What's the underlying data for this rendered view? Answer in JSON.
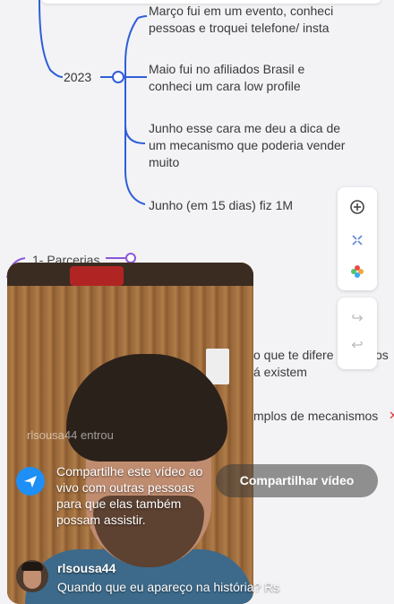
{
  "mindmap": {
    "year": "2023",
    "items": [
      "Março fui em um evento, conheci pessoas e troquei telefone/ insta",
      "Maio fui no afiliados Brasil e conheci um cara low profile",
      "Junho esse cara me deu a dica de um mecanismo que poderia vender muito",
      "Junho (em 15 dias) fiz 1M"
    ],
    "section_label": "1- Parcerias",
    "partial_texts": [
      "o que te difere",
      "á existem",
      "os",
      "mplos de mecanismos"
    ]
  },
  "toolbar": {
    "icons": [
      "add-icon",
      "fit-screen-icon",
      "palette-icon"
    ],
    "icons2": [
      "redo-icon",
      "undo-icon"
    ]
  },
  "live": {
    "joined_text": "rlsousa44 entrou",
    "share_message": "Compartilhe este vídeo ao vivo com outras pessoas para que elas também possam assistir.",
    "share_button": "Compartilhar vídeo",
    "comment": {
      "username": "rlsousa44",
      "text": "Quando que eu apareço na história? Rs"
    }
  },
  "colors": {
    "accent_blue": "#2f5ed8",
    "accent_purple": "#8a56d8",
    "share_icon_blue": "#1e8ff5"
  }
}
